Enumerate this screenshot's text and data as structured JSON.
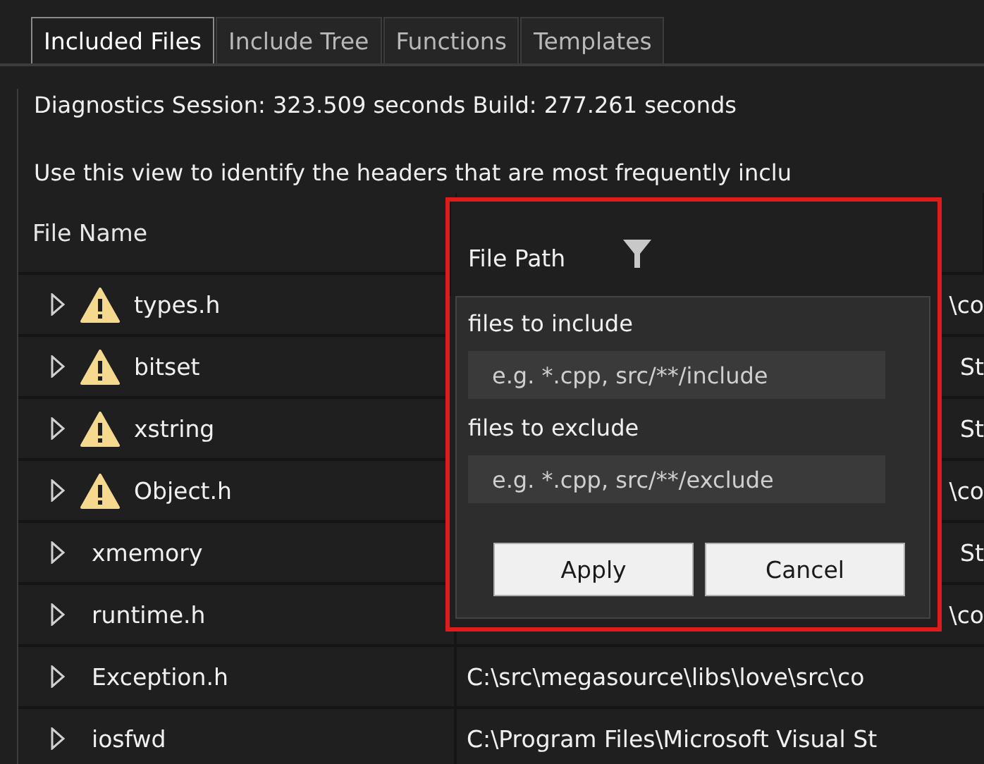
{
  "tabs": [
    {
      "label": "Included Files",
      "selected": true
    },
    {
      "label": "Include Tree",
      "selected": false
    },
    {
      "label": "Functions",
      "selected": false
    },
    {
      "label": "Templates",
      "selected": false
    }
  ],
  "session_info": "Diagnostics Session: 323.509 seconds  Build: 277.261 seconds",
  "description": "Use this view to identify the headers that are most frequently inclu",
  "table": {
    "columns": [
      "File Name",
      "File Path"
    ],
    "rows": [
      {
        "name": "types.h",
        "warning": true,
        "path": "\\co",
        "path_hidden_start": true
      },
      {
        "name": "bitset",
        "warning": true,
        "path": "St",
        "path_hidden_start": true
      },
      {
        "name": "xstring",
        "warning": true,
        "path": "St",
        "path_hidden_start": true
      },
      {
        "name": "Object.h",
        "warning": true,
        "path": "\\co",
        "path_hidden_start": true
      },
      {
        "name": "xmemory",
        "warning": false,
        "path": "St",
        "path_hidden_start": true
      },
      {
        "name": "runtime.h",
        "warning": false,
        "path": "\\co",
        "path_hidden_start": true
      },
      {
        "name": "Exception.h",
        "warning": false,
        "path": "C:\\src\\megasource\\libs\\love\\src\\co",
        "path_hidden_start": false
      },
      {
        "name": "iosfwd",
        "warning": false,
        "path": "C:\\Program Files\\Microsoft Visual St",
        "path_hidden_start": false
      }
    ]
  },
  "filter_popup": {
    "include_label": "files to include",
    "include_placeholder": "e.g. *.cpp, src/**/include",
    "exclude_label": "files to exclude",
    "exclude_placeholder": "e.g. *.cpp, src/**/exclude",
    "buttons": [
      "Apply",
      "Cancel"
    ]
  }
}
